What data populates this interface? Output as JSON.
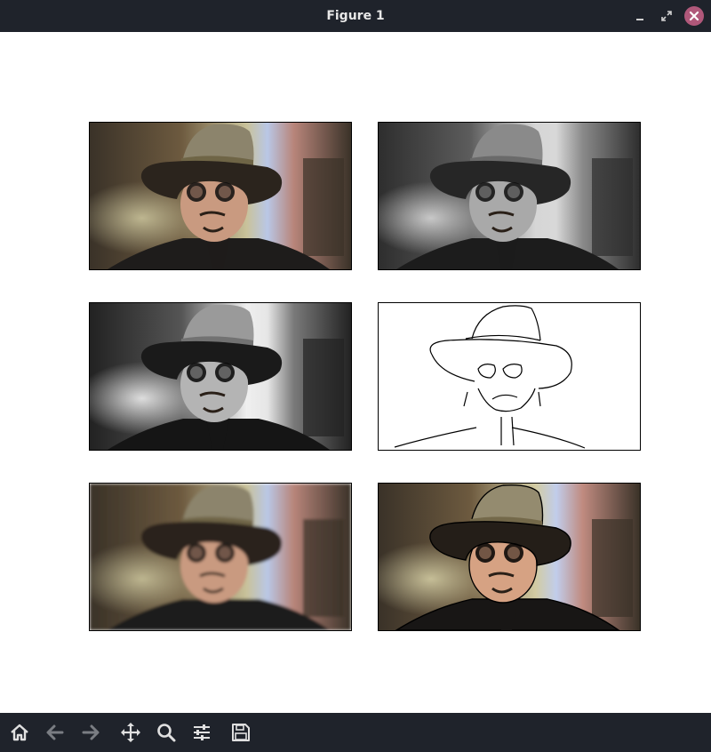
{
  "window": {
    "title": "Figure 1"
  },
  "titlebar_icons": [
    "minimize-icon",
    "maximize-icon",
    "close-icon"
  ],
  "panels": [
    {
      "name": "image-panel-original",
      "variant": "color"
    },
    {
      "name": "image-panel-grayscale",
      "variant": "gray"
    },
    {
      "name": "image-panel-grayscale-equalized",
      "variant": "gray-contrast"
    },
    {
      "name": "image-panel-edges",
      "variant": "edges"
    },
    {
      "name": "image-panel-blurred",
      "variant": "blur"
    },
    {
      "name": "image-panel-cartoon",
      "variant": "cartoon"
    }
  ],
  "toolbar_icons": [
    "home-icon",
    "back-arrow-icon",
    "forward-arrow-icon",
    "pan-move-icon",
    "zoom-icon",
    "configure-subplots-icon",
    "save-icon"
  ],
  "colors": {
    "chrome": "#1f232b",
    "close_button": "#b0587a",
    "icon_active": "#e0e0e0",
    "icon_disabled": "#7a7d83"
  }
}
